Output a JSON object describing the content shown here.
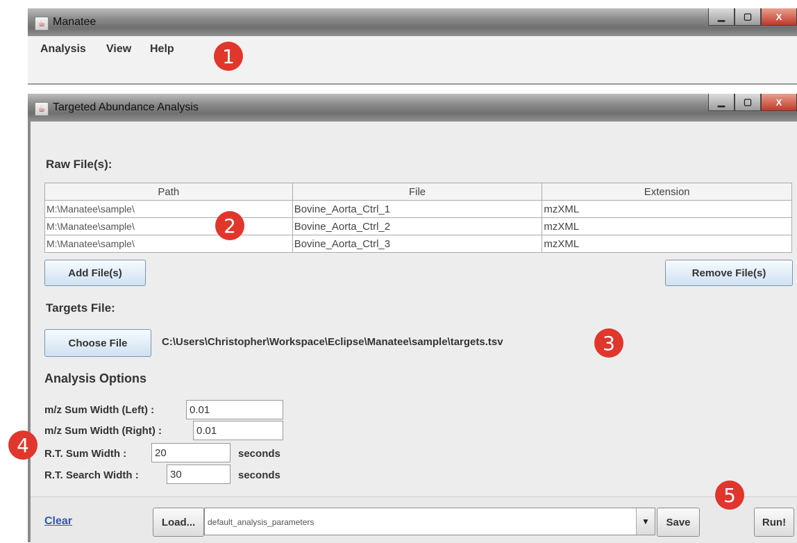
{
  "main_window": {
    "title": "Manatee",
    "menu": [
      {
        "label": "Analysis"
      },
      {
        "label": "View"
      },
      {
        "label": "Help"
      }
    ]
  },
  "window_buttons": {
    "minimize": "▁",
    "maximize": "▢",
    "close": "X"
  },
  "dialog": {
    "title": "Targeted Abundance Analysis",
    "raw_files_label": "Raw File(s):",
    "table": {
      "columns": [
        "Path",
        "File",
        "Extension"
      ],
      "rows": [
        [
          "M:\\Manatee\\sample\\",
          "Bovine_Aorta_Ctrl_1",
          "mzXML"
        ],
        [
          "M:\\Manatee\\sample\\",
          "Bovine_Aorta_Ctrl_2",
          "mzXML"
        ],
        [
          "M:\\Manatee\\sample\\",
          "Bovine_Aorta_Ctrl_3",
          "mzXML"
        ]
      ]
    },
    "add_files_label": "Add File(s)",
    "remove_files_label": "Remove File(s)",
    "targets_file_label": "Targets File:",
    "choose_file_label": "Choose File",
    "targets_path": "C:\\Users\\Christopher\\Workspace\\Eclipse\\Manatee\\sample\\targets.tsv",
    "analysis_options_label": "Analysis Options",
    "options": {
      "mz_left_label": "m/z Sum Width (Left) :",
      "mz_left_value": "0.01",
      "mz_right_label": "m/z Sum Width (Right) :",
      "mz_right_value": "0.01",
      "rt_sum_label": "R.T. Sum Width :",
      "rt_sum_value": "20",
      "rt_search_label": "R.T. Search Width :",
      "rt_search_value": "30",
      "unit_seconds": "seconds"
    },
    "bottom": {
      "clear_label": "Clear",
      "load_label": "Load...",
      "params_value": "default_analysis_parameters",
      "save_label": "Save",
      "run_label": "Run!"
    }
  },
  "callouts": [
    "1",
    "2",
    "3",
    "4",
    "5"
  ],
  "colors": {
    "callout": "#e0362c",
    "link": "#2a5caa"
  }
}
